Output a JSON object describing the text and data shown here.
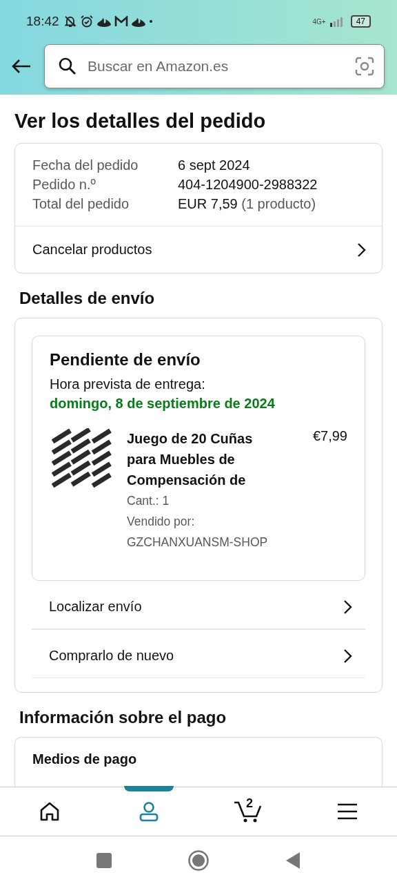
{
  "status_bar": {
    "time": "18:42",
    "network": "4G+",
    "battery": "47"
  },
  "search": {
    "placeholder": "Buscar en Amazon.es"
  },
  "page_title": "Ver los detalles del pedido",
  "order_summary": {
    "rows": [
      {
        "label": "Fecha del pedido",
        "value": "6 sept 2024"
      },
      {
        "label": "Pedido n.º",
        "value": "404-1204900-2988322"
      },
      {
        "label": "Total del pedido",
        "value": "EUR 7,59",
        "note": "(1 producto)"
      }
    ],
    "action": "Cancelar productos"
  },
  "shipping": {
    "heading": "Detalles de envío",
    "status": "Pendiente de envío",
    "eta_label": "Hora prevista de entrega:",
    "eta_date": "domingo, 8 de septiembre de 2024",
    "item": {
      "title": "Juego de 20 Cuñas para Muebles de Compensación de",
      "price": "€7,99",
      "quantity": "Cant.: 1",
      "seller": "Vendido por: GZCHANXUANSM-SHOP"
    },
    "actions": [
      "Localizar envío",
      "Comprarlo de nuevo"
    ]
  },
  "payment": {
    "heading": "Información sobre el pago",
    "card_title": "Medios de pago"
  },
  "nav": {
    "items": [
      {
        "kind": "home",
        "selected": false
      },
      {
        "kind": "account",
        "selected": true
      },
      {
        "kind": "cart",
        "selected": false,
        "badge": "2"
      },
      {
        "kind": "menu",
        "selected": false
      }
    ]
  }
}
